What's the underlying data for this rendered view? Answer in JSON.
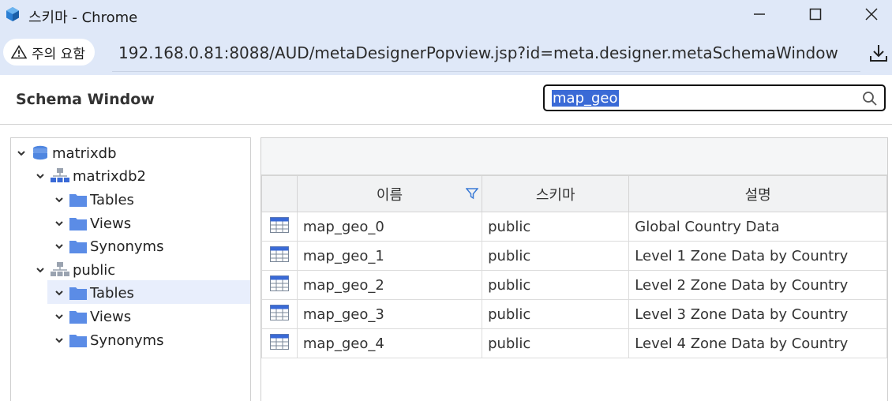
{
  "window": {
    "title": "스키마 - Chrome",
    "minimize_icon": "minimize-icon",
    "maximize_icon": "maximize-icon",
    "close_icon": "close-icon"
  },
  "address_bar": {
    "security_label": "주의 요함",
    "url": "192.168.0.81:8088/AUD/metaDesignerPopview.jsp?id=meta.designer.metaSchemaWindow",
    "download_icon": "download-icon"
  },
  "header": {
    "title": "Schema Window",
    "search_value": "map_geo"
  },
  "tree": {
    "root": "matrixdb",
    "schemas": [
      {
        "name": "matrixdb2",
        "children": [
          "Tables",
          "Views",
          "Synonyms"
        ]
      },
      {
        "name": "public",
        "children": [
          "Tables",
          "Views",
          "Synonyms"
        ]
      }
    ],
    "selected": "public/Tables"
  },
  "grid": {
    "columns": [
      "이름",
      "스키마",
      "설명"
    ],
    "rows": [
      {
        "name": "map_geo_0",
        "schema": "public",
        "desc": "Global Country Data"
      },
      {
        "name": "map_geo_1",
        "schema": "public",
        "desc": "Level 1 Zone Data by Country"
      },
      {
        "name": "map_geo_2",
        "schema": "public",
        "desc": "Level 2 Zone Data by Country"
      },
      {
        "name": "map_geo_3",
        "schema": "public",
        "desc": "Level 3 Zone Data by Country"
      },
      {
        "name": "map_geo_4",
        "schema": "public",
        "desc": "Level 4 Zone Data by Country"
      }
    ]
  },
  "colors": {
    "titlebar_bg": "#dfe8f8",
    "folder": "#5b8ce6",
    "selection_highlight": "#3a6ad6",
    "selected_row_bg": "#e8eefc"
  }
}
